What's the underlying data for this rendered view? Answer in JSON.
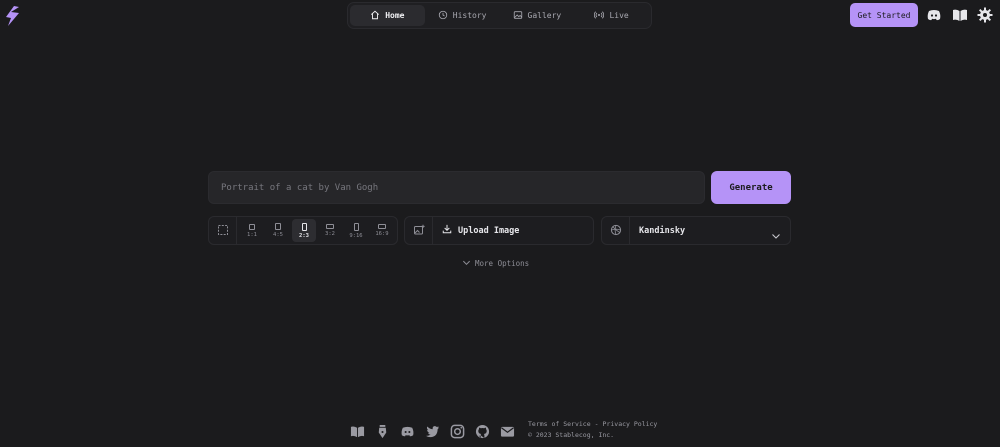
{
  "nav": {
    "items": [
      {
        "label": "Home",
        "icon": "home-icon",
        "active": true
      },
      {
        "label": "History",
        "icon": "history-icon",
        "active": false
      },
      {
        "label": "Gallery",
        "icon": "gallery-icon",
        "active": false
      },
      {
        "label": "Live",
        "icon": "live-icon",
        "active": false
      }
    ]
  },
  "header": {
    "get_started_label": "Get Started",
    "icons": [
      "discord-icon",
      "docs-book-icon",
      "settings-gear-icon"
    ]
  },
  "prompt": {
    "placeholder": "Portrait of a cat by Van Gogh",
    "value": "",
    "generate_label": "Generate"
  },
  "aspect_ratio": {
    "options": [
      "1:1",
      "4:5",
      "2:3",
      "3:2",
      "9:16",
      "16:9"
    ],
    "selected": "2:3"
  },
  "upload": {
    "label": "Upload Image"
  },
  "model": {
    "selected": "Kandinsky"
  },
  "more_options": {
    "label": "More Options"
  },
  "footer": {
    "icons": [
      "book-icon",
      "pen-nib-icon",
      "discord-icon",
      "twitter-icon",
      "instagram-icon",
      "github-icon",
      "mail-icon"
    ],
    "terms": "Terms of Service",
    "separator": "-",
    "privacy": "Privacy Policy",
    "copyright": "© 2023 Stablecog, Inc."
  },
  "colors": {
    "background": "#1b1b1d",
    "accent": "#b593f7",
    "panel": "#1d1d20",
    "input": "#262629"
  }
}
